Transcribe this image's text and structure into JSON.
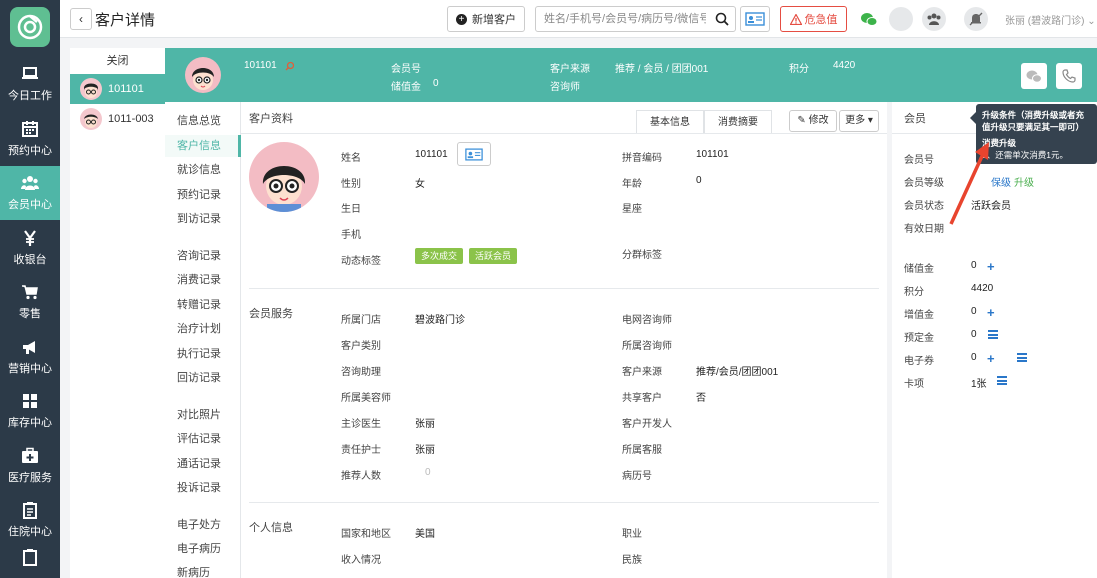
{
  "sidebar": {
    "items": [
      {
        "label": "今日工作",
        "icon": "laptop-icon"
      },
      {
        "label": "预约中心",
        "icon": "calendar-icon"
      },
      {
        "label": "会员中心",
        "icon": "users-icon"
      },
      {
        "label": "收银台",
        "icon": "yen-icon"
      },
      {
        "label": "零售",
        "icon": "cart-icon"
      },
      {
        "label": "营销中心",
        "icon": "megaphone-icon"
      },
      {
        "label": "库存中心",
        "icon": "grid-icon"
      },
      {
        "label": "医疗服务",
        "icon": "medkit-icon"
      },
      {
        "label": "住院中心",
        "icon": "clipboard-icon"
      }
    ],
    "active_index": 2
  },
  "header": {
    "title": "客户详情",
    "new_customer": "新增客户",
    "search_placeholder": "姓名/手机号/会员号/病历号/微信号",
    "crisis_label": "危急值",
    "user": "张丽 (碧波路门诊)"
  },
  "tabs": {
    "close": "关闭",
    "customers": [
      "101101",
      "1011-003"
    ]
  },
  "band": {
    "name": "101101",
    "member_no_label": "会员号",
    "stored_label": "储值金",
    "stored_value": "0",
    "source_label": "客户来源",
    "source_value": "推荐 / 会员 / 团团001",
    "consultant_label": "咨询师",
    "points_label": "积分",
    "points_value": "4420"
  },
  "sidenav": {
    "group1": [
      "信息总览",
      "客户信息",
      "就诊信息",
      "预约记录",
      "到访记录"
    ],
    "group2": [
      "咨询记录",
      "消费记录",
      "转赠记录",
      "治疗计划",
      "执行记录",
      "回访记录"
    ],
    "group3": [
      "对比照片",
      "评估记录",
      "通话记录",
      "投诉记录"
    ],
    "group4": [
      "电子处方",
      "电子病历",
      "新病历"
    ],
    "active": "客户信息"
  },
  "main": {
    "profile_title": "客户资料",
    "tab_basic": "基本信息",
    "tab_consume": "消费摘要",
    "edit": "修改",
    "more": "更多",
    "basic": {
      "name_label": "姓名",
      "name_value": "101101",
      "gender_label": "性别",
      "gender_value": "女",
      "birthday_label": "生日",
      "phone_label": "手机",
      "tags_label": "动态标签",
      "tags": [
        "多次成交",
        "活跃会员"
      ],
      "pinyin_label": "拼音编码",
      "pinyin_value": "101101",
      "age_label": "年龄",
      "age_value": "0",
      "zodiac_label": "星座",
      "group_tag_label": "分群标签"
    },
    "service_title": "会员服务",
    "service": {
      "store_label": "所属门店",
      "store_value": "碧波路门诊",
      "category_label": "客户类别",
      "assistant_label": "咨询助理",
      "beautician_label": "所属美容师",
      "doctor_label": "主诊医生",
      "doctor_value": "张丽",
      "nurse_label": "责任护士",
      "nurse_value": "张丽",
      "referrals_label": "推荐人数",
      "referrals_value": "0",
      "tele_label": "电网咨询师",
      "consultant_label": "所属咨询师",
      "source_label": "客户来源",
      "source_value": "推荐/会员/团团001",
      "shared_label": "共享客户",
      "shared_value": "否",
      "developer_label": "客户开发人",
      "cs_label": "所属客服",
      "record_label": "病历号"
    },
    "personal_title": "个人信息",
    "personal": {
      "country_label": "国家和地区",
      "country_value": "美国",
      "income_label": "收入情况",
      "job_label": "职业",
      "ethnic_label": "民族"
    }
  },
  "right": {
    "title": "会员",
    "member_no_label": "会员号",
    "level_label": "会员等级",
    "level_value": "保级",
    "upgrade_label": "升级",
    "status_label": "会员状态",
    "status_value": "活跃会员",
    "expiry_label": "有效日期",
    "stored_label": "储值金",
    "stored_value": "0",
    "points_label": "积分",
    "points_value": "4420",
    "bonus_label": "增值金",
    "bonus_value": "0",
    "deposit_label": "预定金",
    "deposit_value": "0",
    "coupon_label": "电子券",
    "coupon_value": "0",
    "card_label": "卡项",
    "card_value": "1张"
  },
  "tooltip": {
    "line1": "升级条件（消费升级或者充值升级只要满足其一即可）",
    "line2": "消费升级",
    "line3": "1、还需单次消费1元。"
  },
  "colors": {
    "teal": "#4fb6a7",
    "sidebar": "#2c3a48",
    "red": "#e54d42",
    "arrow": "#e8442e"
  }
}
